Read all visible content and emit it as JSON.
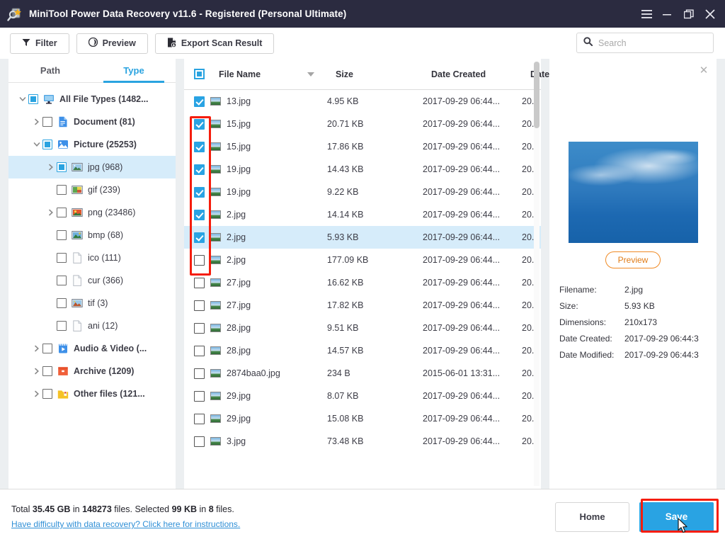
{
  "window": {
    "title": "MiniTool Power Data Recovery v11.6 - Registered (Personal Ultimate)",
    "app_icon": "magnifier-disk-icon",
    "controls": [
      {
        "name": "menu-button",
        "glyph": "☰"
      },
      {
        "name": "minimize-button",
        "glyph": "–"
      },
      {
        "name": "restore-button",
        "glyph": "❐"
      },
      {
        "name": "close-button",
        "glyph": "✕"
      }
    ]
  },
  "toolbar": {
    "filter_label": "Filter",
    "preview_label": "Preview",
    "export_label": "Export Scan Result",
    "search_placeholder": "Search",
    "search_value": ""
  },
  "sidebar": {
    "tabs": [
      {
        "label": "Path",
        "active": false
      },
      {
        "label": "Type",
        "active": true
      }
    ],
    "items": [
      {
        "label": "All File Types (1482...",
        "indent": 0,
        "arrow": "down",
        "check": "partial",
        "icon": "monitor-icon",
        "bold": true,
        "selected": false
      },
      {
        "label": "Document (81)",
        "indent": 1,
        "arrow": "right",
        "check": "empty",
        "icon": "document-icon",
        "bold": true,
        "selected": false
      },
      {
        "label": "Picture (25253)",
        "indent": 1,
        "arrow": "down",
        "check": "partial",
        "icon": "picture-icon",
        "bold": true,
        "selected": false
      },
      {
        "label": "jpg (968)",
        "indent": 2,
        "arrow": "right",
        "check": "partial",
        "icon": "jpg-icon",
        "bold": false,
        "selected": true
      },
      {
        "label": "gif (239)",
        "indent": 2,
        "arrow": "none",
        "check": "empty",
        "icon": "gif-icon",
        "bold": false,
        "selected": false
      },
      {
        "label": "png (23486)",
        "indent": 2,
        "arrow": "right",
        "check": "empty",
        "icon": "png-icon",
        "bold": false,
        "selected": false
      },
      {
        "label": "bmp (68)",
        "indent": 2,
        "arrow": "none",
        "check": "empty",
        "icon": "bmp-icon",
        "bold": false,
        "selected": false
      },
      {
        "label": "ico (111)",
        "indent": 2,
        "arrow": "none",
        "check": "empty",
        "icon": "blank-file-icon",
        "bold": false,
        "selected": false
      },
      {
        "label": "cur (366)",
        "indent": 2,
        "arrow": "none",
        "check": "empty",
        "icon": "blank-file-icon",
        "bold": false,
        "selected": false
      },
      {
        "label": "tif (3)",
        "indent": 2,
        "arrow": "none",
        "check": "empty",
        "icon": "tif-icon",
        "bold": false,
        "selected": false
      },
      {
        "label": "ani (12)",
        "indent": 2,
        "arrow": "none",
        "check": "empty",
        "icon": "blank-file-icon",
        "bold": false,
        "selected": false
      },
      {
        "label": "Audio & Video (...",
        "indent": 1,
        "arrow": "right",
        "check": "empty",
        "icon": "video-icon",
        "bold": true,
        "selected": false
      },
      {
        "label": "Archive (1209)",
        "indent": 1,
        "arrow": "right",
        "check": "empty",
        "icon": "archive-icon",
        "bold": true,
        "selected": false
      },
      {
        "label": "Other files (121...",
        "indent": 1,
        "arrow": "right",
        "check": "empty",
        "icon": "otherfiles-icon",
        "bold": true,
        "selected": false
      }
    ]
  },
  "filelist": {
    "header_checkbox_state": "partial",
    "columns": [
      {
        "key": "name",
        "label": "File Name",
        "sorted": true
      },
      {
        "key": "size",
        "label": "Size",
        "sorted": false
      },
      {
        "key": "created",
        "label": "Date Created",
        "sorted": false
      },
      {
        "key": "modified",
        "label": "Date M",
        "sorted": false
      }
    ],
    "rows": [
      {
        "checked": true,
        "name": "13.jpg",
        "size": "4.95 KB",
        "created": "2017-09-29 06:44...",
        "modified": "20...",
        "selected": false
      },
      {
        "checked": true,
        "name": "15.jpg",
        "size": "20.71 KB",
        "created": "2017-09-29 06:44...",
        "modified": "20...",
        "selected": false
      },
      {
        "checked": true,
        "name": "15.jpg",
        "size": "17.86 KB",
        "created": "2017-09-29 06:44...",
        "modified": "20...",
        "selected": false
      },
      {
        "checked": true,
        "name": "19.jpg",
        "size": "14.43 KB",
        "created": "2017-09-29 06:44...",
        "modified": "20...",
        "selected": false
      },
      {
        "checked": true,
        "name": "19.jpg",
        "size": "9.22 KB",
        "created": "2017-09-29 06:44...",
        "modified": "20...",
        "selected": false
      },
      {
        "checked": true,
        "name": "2.jpg",
        "size": "14.14 KB",
        "created": "2017-09-29 06:44...",
        "modified": "20...",
        "selected": false
      },
      {
        "checked": true,
        "name": "2.jpg",
        "size": "5.93 KB",
        "created": "2017-09-29 06:44...",
        "modified": "20...",
        "selected": true
      },
      {
        "checked": false,
        "name": "2.jpg",
        "size": "177.09 KB",
        "created": "2017-09-29 06:44...",
        "modified": "20...",
        "selected": false
      },
      {
        "checked": false,
        "name": "27.jpg",
        "size": "16.62 KB",
        "created": "2017-09-29 06:44...",
        "modified": "20...",
        "selected": false
      },
      {
        "checked": false,
        "name": "27.jpg",
        "size": "17.82 KB",
        "created": "2017-09-29 06:44...",
        "modified": "20...",
        "selected": false
      },
      {
        "checked": false,
        "name": "28.jpg",
        "size": "9.51 KB",
        "created": "2017-09-29 06:44...",
        "modified": "20...",
        "selected": false
      },
      {
        "checked": false,
        "name": "28.jpg",
        "size": "14.57 KB",
        "created": "2017-09-29 06:44...",
        "modified": "20...",
        "selected": false
      },
      {
        "checked": false,
        "name": "2874baa0.jpg",
        "size": "234 B",
        "created": "2015-06-01 13:31...",
        "modified": "20...",
        "selected": false
      },
      {
        "checked": false,
        "name": "29.jpg",
        "size": "8.07 KB",
        "created": "2017-09-29 06:44...",
        "modified": "20...",
        "selected": false
      },
      {
        "checked": false,
        "name": "29.jpg",
        "size": "15.08 KB",
        "created": "2017-09-29 06:44...",
        "modified": "20...",
        "selected": false
      },
      {
        "checked": false,
        "name": "3.jpg",
        "size": "73.48 KB",
        "created": "2017-09-29 06:44...",
        "modified": "20...",
        "selected": false
      }
    ]
  },
  "preview": {
    "close_glyph": "✕",
    "button_label": "Preview",
    "meta": [
      {
        "key": "Filename:",
        "value": "2.jpg"
      },
      {
        "key": "Size:",
        "value": "5.93 KB"
      },
      {
        "key": "Dimensions:",
        "value": "210x173"
      },
      {
        "key": "Date Created:",
        "value": "2017-09-29 06:44:3"
      },
      {
        "key": "Date Modified:",
        "value": "2017-09-29 06:44:3"
      }
    ]
  },
  "footer": {
    "status_prefix": "Total ",
    "total_size": "35.45 GB",
    "status_mid1": " in ",
    "total_files": "148273",
    "status_mid2": " files.  Selected ",
    "selected_size": "99 KB",
    "status_mid3": " in ",
    "selected_files": "8",
    "status_suffix": " files.",
    "help_link": "Have difficulty with data recovery? Click here for instructions.",
    "home_label": "Home",
    "save_label": "Save"
  },
  "colors": {
    "titlebar": "#2b2b40",
    "accent": "#29a3e3",
    "selection": "#d6ecfa",
    "highlight": "#f51d0c",
    "orange": "#e07b16",
    "link": "#2f8fd6"
  }
}
